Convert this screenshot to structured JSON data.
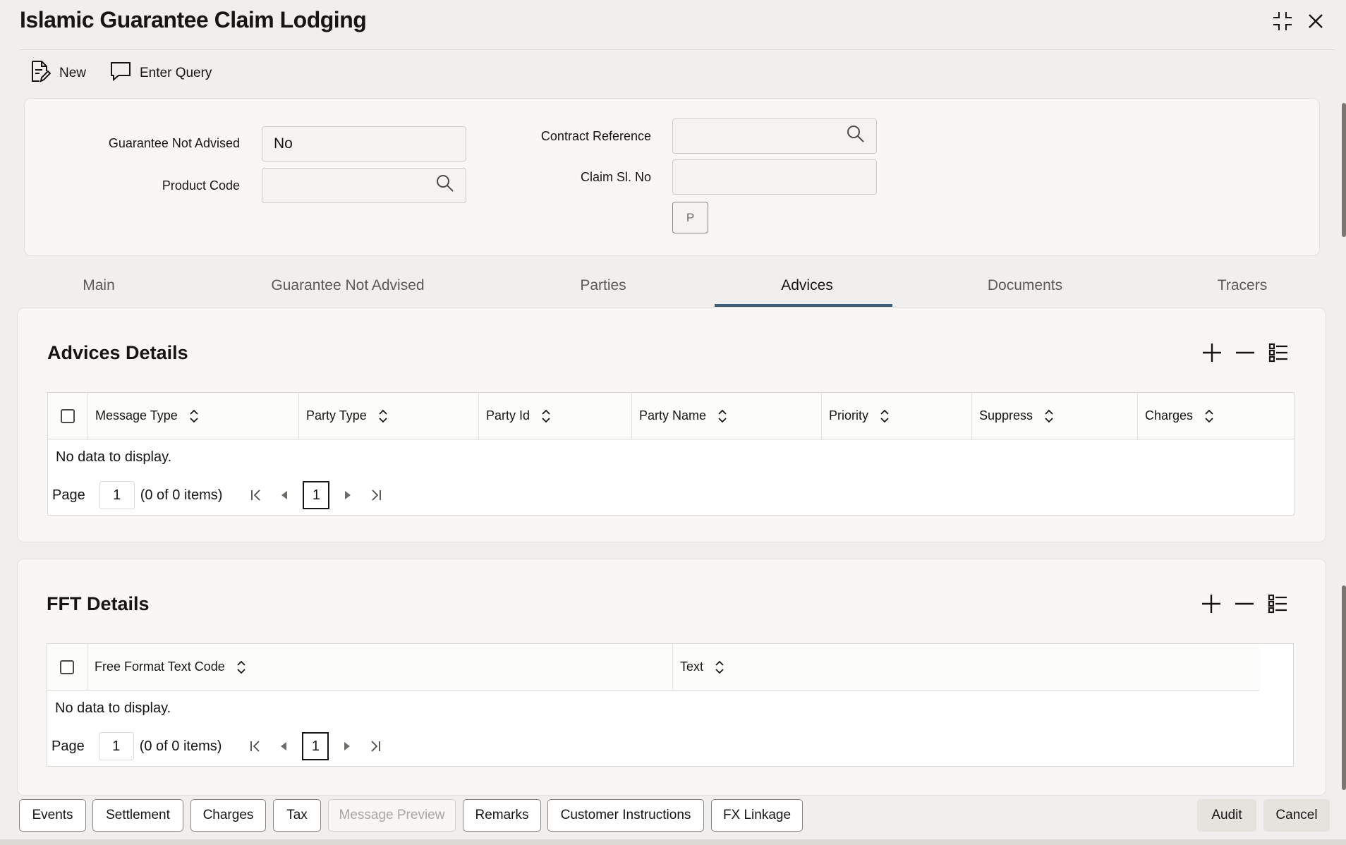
{
  "window": {
    "title": "Islamic Guarantee Claim Lodging"
  },
  "toolbar": {
    "new_label": "New",
    "enter_query_label": "Enter Query"
  },
  "form": {
    "guarantee_not_advised_label": "Guarantee Not Advised",
    "guarantee_not_advised_value": "No",
    "product_code_label": "Product Code",
    "product_code_value": "",
    "contract_reference_label": "Contract Reference",
    "contract_reference_value": "",
    "claim_sl_no_label": "Claim Sl. No",
    "claim_sl_no_value": "",
    "p_button_label": "P"
  },
  "tabs": [
    {
      "label": "Main"
    },
    {
      "label": "Guarantee Not Advised"
    },
    {
      "label": "Parties"
    },
    {
      "label": "Advices",
      "active": true
    },
    {
      "label": "Documents"
    },
    {
      "label": "Tracers"
    }
  ],
  "advices": {
    "title": "Advices Details",
    "columns": [
      "Message Type",
      "Party Type",
      "Party Id",
      "Party Name",
      "Priority",
      "Suppress",
      "Charges"
    ],
    "no_data": "No data to display.",
    "page_label": "Page",
    "page_value": "1",
    "items_text": "(0 of 0 items)",
    "current_page": "1"
  },
  "fft": {
    "title": "FFT Details",
    "columns": [
      "Free Format Text Code",
      "Text"
    ],
    "no_data": "No data to display.",
    "page_label": "Page",
    "page_value": "1",
    "items_text": "(0 of 0 items)",
    "current_page": "1"
  },
  "footer": {
    "events": "Events",
    "settlement": "Settlement",
    "charges": "Charges",
    "tax": "Tax",
    "message_preview": "Message Preview",
    "remarks": "Remarks",
    "customer_instructions": "Customer Instructions",
    "fx_linkage": "FX Linkage",
    "audit": "Audit",
    "cancel": "Cancel"
  }
}
